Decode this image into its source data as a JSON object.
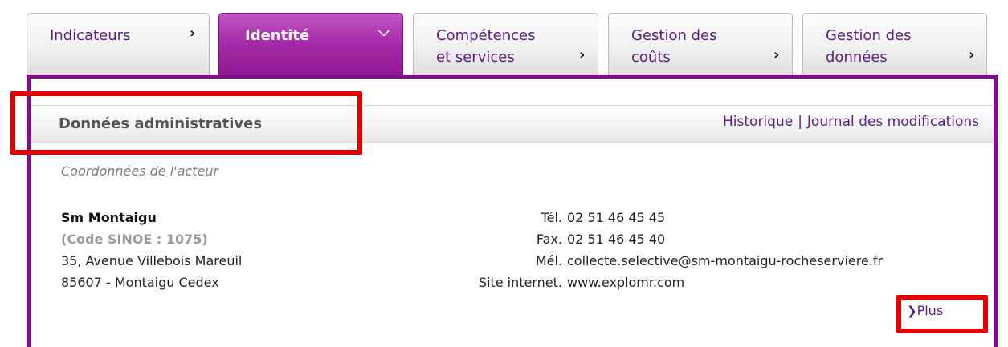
{
  "tabs": [
    {
      "label_line1": "Indicateurs",
      "label_line2": "",
      "icon": "chevron-right-icon",
      "active": false
    },
    {
      "label_line1": "Identité",
      "label_line2": "",
      "icon": "chevron-down-icon",
      "active": true
    },
    {
      "label_line1": "Compétences",
      "label_line2": "et services",
      "icon": "chevron-right-icon",
      "active": false
    },
    {
      "label_line1": "Gestion des",
      "label_line2": "coûts",
      "icon": "chevron-right-icon",
      "active": false
    },
    {
      "label_line1": "Gestion des",
      "label_line2": "données",
      "icon": "chevron-right-icon",
      "active": false
    }
  ],
  "section": {
    "title": "Données administratives",
    "link_history": "Historique",
    "link_separator": "|",
    "link_journal": "Journal des modifications"
  },
  "subheading": "Coordonnées de l'acteur",
  "address": {
    "name": "Sm Montaigu",
    "code": "(Code SINOE : 1075)",
    "street": "35, Avenue Villebois Mareuil",
    "city": "85607 - Montaigu Cedex"
  },
  "contact": {
    "tel_label": "Tél.",
    "tel_value": "02 51 46 45 45",
    "fax_label": "Fax.",
    "fax_value": "02 51 46 45 40",
    "mel_label": "Mél.",
    "mel_value": "collecte.selective@sm-montaigu-rocheserviere.fr",
    "site_label": "Site internet.",
    "site_value": "www.explomr.com"
  },
  "more_link": {
    "label": "Plus",
    "icon": "chevron-right-icon"
  },
  "colors": {
    "accent": "#850c8c",
    "highlight": "#e50000",
    "link": "#5a1d86"
  }
}
